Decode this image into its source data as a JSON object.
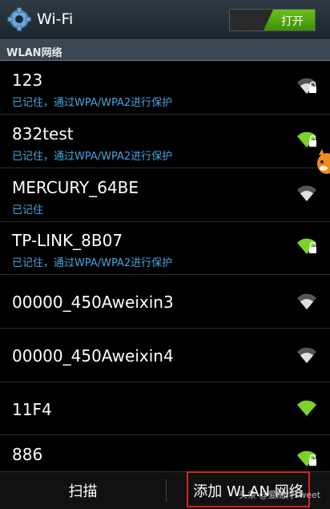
{
  "header": {
    "title": "Wi-Fi",
    "toggle_label": "打开"
  },
  "section": {
    "label": "WLAN网络"
  },
  "networks": [
    {
      "ssid": "123",
      "status": "已记住，通过WPA/WPA2进行保护",
      "secured": true,
      "signal": "medium"
    },
    {
      "ssid": "832test",
      "status": "已记住，通过WPA/WPA2进行保护",
      "secured": true,
      "signal": "green"
    },
    {
      "ssid": "MERCURY_64BE",
      "status": "已记住",
      "secured": false,
      "signal": "medium"
    },
    {
      "ssid": "TP-LINK_8B07",
      "status": "已记住，通过WPA/WPA2进行保护",
      "secured": true,
      "signal": "green"
    },
    {
      "ssid": "00000_450Aweixin3",
      "status": "",
      "secured": false,
      "signal": "medium"
    },
    {
      "ssid": "00000_450Aweixin4",
      "status": "",
      "secured": false,
      "signal": "medium"
    },
    {
      "ssid": "11F4",
      "status": "",
      "secured": false,
      "signal": "green"
    },
    {
      "ssid": "886",
      "status": "",
      "secured": true,
      "signal": "green"
    }
  ],
  "footer": {
    "scan_label": "扫描",
    "add_label": "添加 WLAN 网络"
  },
  "watermark": "头条 @爱随行sweet",
  "colors": {
    "accent_green": "#6bbf1e",
    "status_blue": "#46a6dd",
    "highlight_red": "#e02020"
  }
}
